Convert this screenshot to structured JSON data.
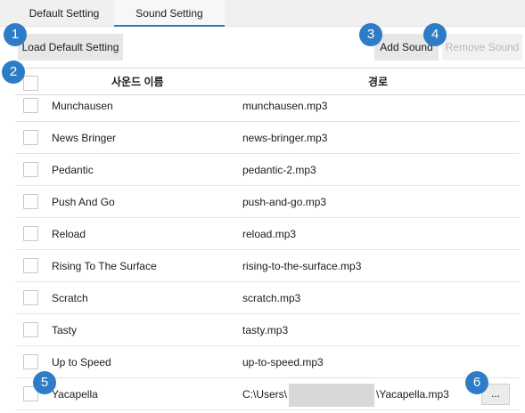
{
  "tabs": [
    {
      "label": "Default Setting"
    },
    {
      "label": "Sound Setting"
    }
  ],
  "toolbar": {
    "load_default_label": "Load Default Setting",
    "add_sound_label": "Add Sound",
    "remove_sound_label": "Remove Sound"
  },
  "table": {
    "headers": {
      "name": "사운드 이름",
      "path": "경로"
    },
    "rows": [
      {
        "name": "Munchausen",
        "path": "munchausen.mp3"
      },
      {
        "name": "News Bringer",
        "path": "news-bringer.mp3"
      },
      {
        "name": "Pedantic",
        "path": "pedantic-2.mp3"
      },
      {
        "name": "Push And Go",
        "path": "push-and-go.mp3"
      },
      {
        "name": "Reload",
        "path": "reload.mp3"
      },
      {
        "name": "Rising To The Surface",
        "path": "rising-to-the-surface.mp3"
      },
      {
        "name": "Scratch",
        "path": "scratch.mp3"
      },
      {
        "name": "Tasty",
        "path": "tasty.mp3"
      },
      {
        "name": "Up to Speed",
        "path": "up-to-speed.mp3"
      },
      {
        "name": "Yacapella",
        "path_prefix": "C:\\Users\\",
        "path_suffix": "\\Yacapella.mp3"
      }
    ],
    "browse_label": "..."
  },
  "annotations": [
    "1",
    "2",
    "3",
    "4",
    "5",
    "6"
  ],
  "colors": {
    "badge": "#2e7cc6",
    "tab_active_underline": "#2b7dbd",
    "button_bg": "#e7e7e7",
    "disabled_text": "#b8b8b8"
  }
}
